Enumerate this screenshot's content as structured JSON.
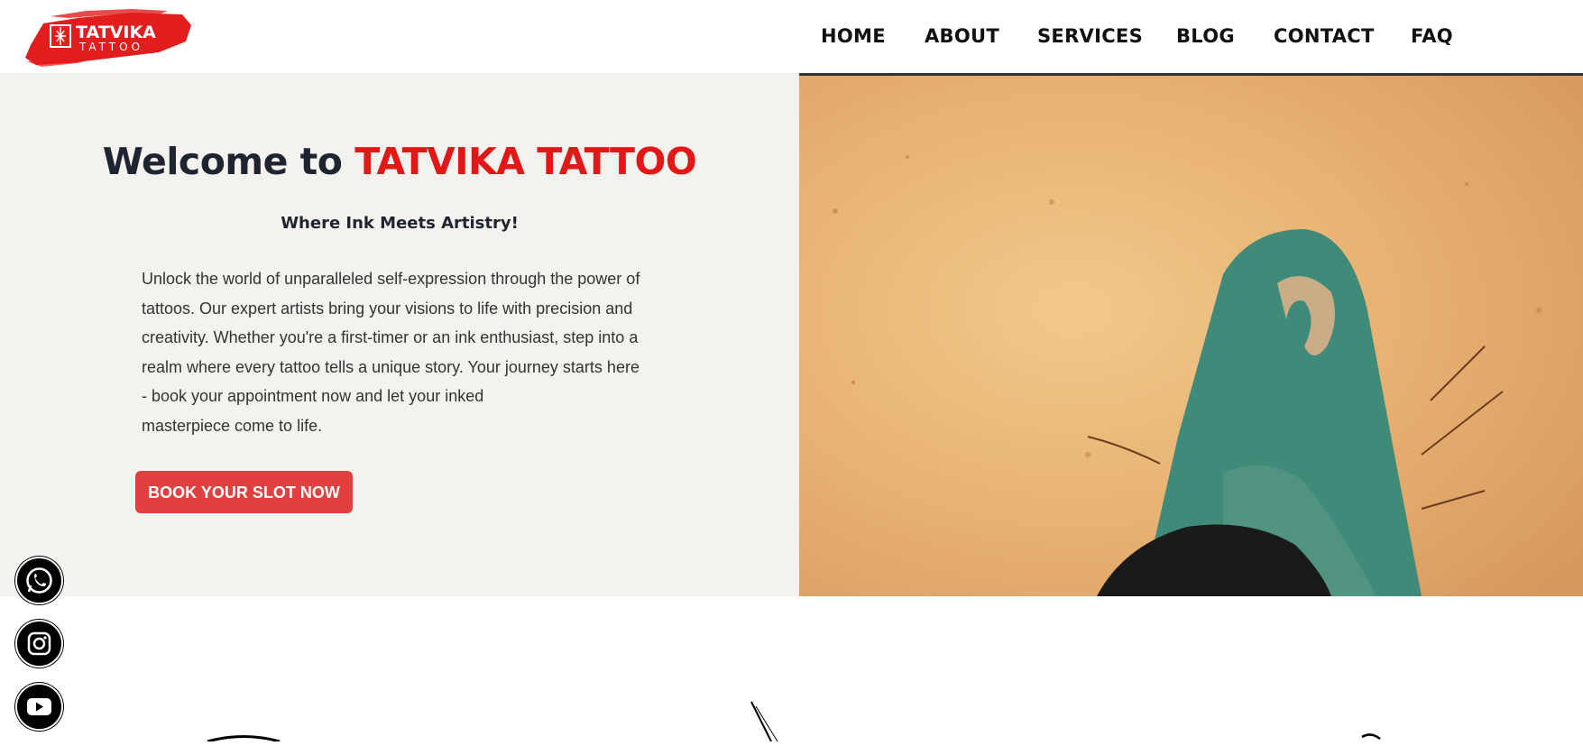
{
  "header": {
    "logo_text": "TATVIKA",
    "logo_subtext": "TATTOO",
    "nav": [
      {
        "label": "HOME"
      },
      {
        "label": "ABOUT"
      },
      {
        "label": "SERVICES"
      },
      {
        "label": "BLOG"
      },
      {
        "label": "CONTACT"
      },
      {
        "label": "FAQ"
      }
    ]
  },
  "hero": {
    "welcome_prefix": "Welcome to ",
    "welcome_brand": "TATVIKA TATTOO",
    "tagline": "Where Ink Meets Artistry!",
    "intro_lines": [
      "Unlock the world of unparalleled self-expression through the power of",
      "tattoos. Our expert artists bring your visions to life with precision and",
      "creativity. Whether you're a first-timer or an ink enthusiast, step into a",
      "realm where every tattoo tells a unique story. Your journey starts here",
      "- book your appointment now and let your inked",
      "masterpiece come to life."
    ],
    "cta_label": "BOOK YOUR SLOT NOW"
  },
  "social": [
    {
      "icon": "whatsapp-icon"
    },
    {
      "icon": "instagram-icon"
    },
    {
      "icon": "youtube-icon"
    }
  ],
  "colors": {
    "brand_red": "#e11818",
    "cta_red": "#e04040",
    "hero_bg": "#f4f2ef",
    "heading": "#1f2530"
  }
}
